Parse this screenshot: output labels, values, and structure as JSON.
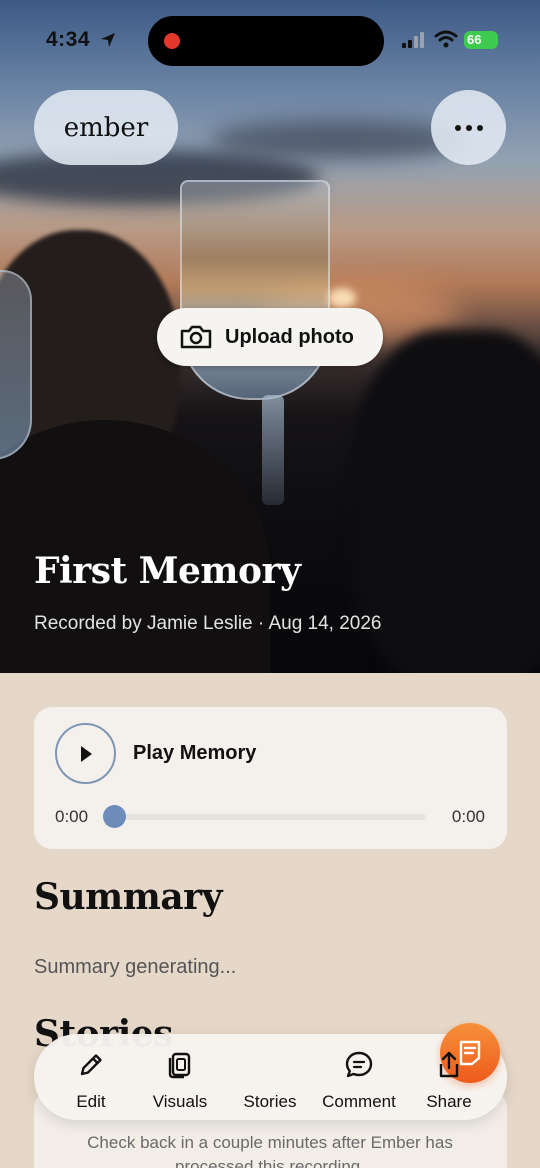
{
  "status_bar": {
    "time": "4:34",
    "battery": "66"
  },
  "header": {
    "brand": "ember"
  },
  "hero": {
    "upload_label": "Upload photo"
  },
  "memory": {
    "title": "First Memory",
    "subtitle": "Recorded by Jamie Leslie · Aug 14, 2026"
  },
  "player": {
    "label": "Play Memory",
    "current_time": "0:00",
    "duration": "0:00",
    "progress": 0
  },
  "summary": {
    "heading": "Summary",
    "text": "Summary generating..."
  },
  "stories": {
    "heading": "Stories",
    "message": "Check back in a couple minutes after Ember has processed this recording."
  },
  "tabbar": {
    "edit": "Edit",
    "visuals": "Visuals",
    "stories": "Stories",
    "comment": "Comment",
    "share": "Share"
  },
  "colors": {
    "accent": "#ee5a1c",
    "player_knob": "#6d8cba",
    "recording": "#e5382d",
    "battery": "#3ccb4e"
  }
}
